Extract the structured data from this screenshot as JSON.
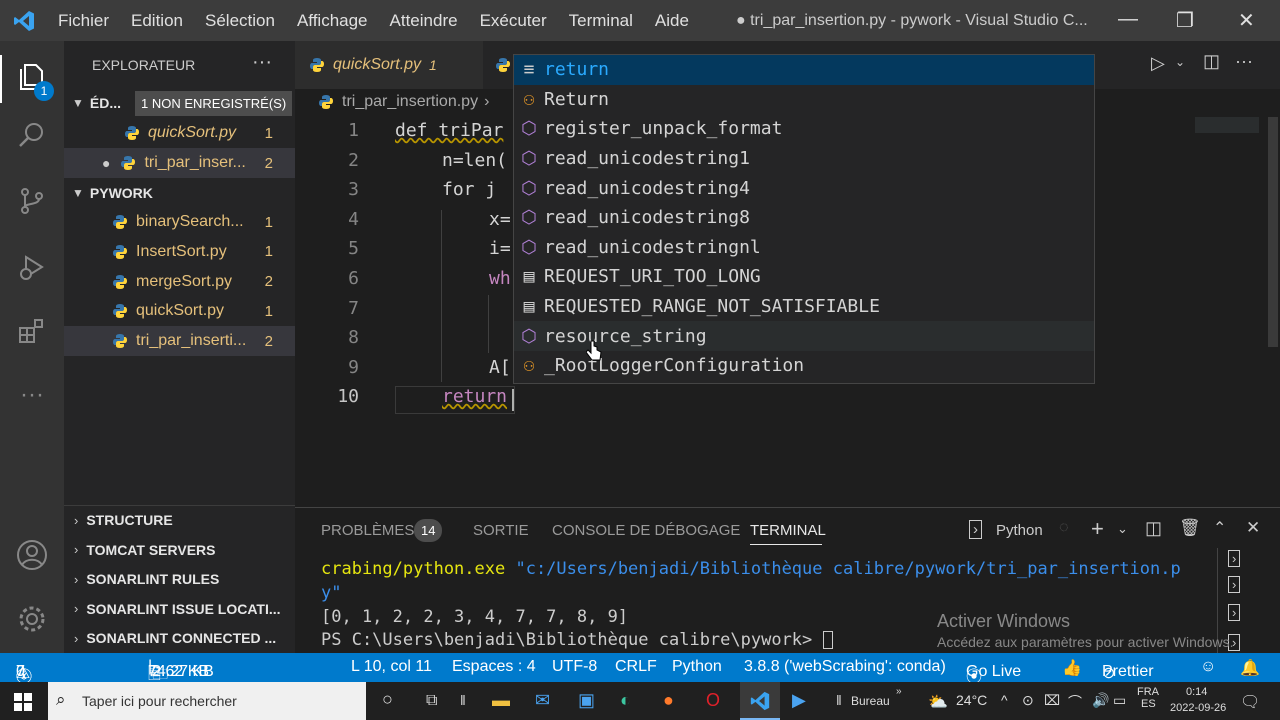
{
  "menu": [
    "Fichier",
    "Edition",
    "Sélection",
    "Affichage",
    "Atteindre",
    "Exécuter",
    "Terminal",
    "Aide"
  ],
  "window_title": "● tri_par_insertion.py - pywork - Visual Studio C...",
  "sidebar": {
    "title": "EXPLORATEUR",
    "open_editors_label": "ÉD...",
    "unsaved_label": "1 NON ENREGISTRÉ(S)",
    "open_editors": [
      {
        "name": "quickSort.py",
        "count": "1"
      },
      {
        "name": "tri_par_inser...",
        "count": "2"
      }
    ],
    "folder": "PYWORK",
    "files": [
      {
        "name": "binarySearch...",
        "count": "1"
      },
      {
        "name": "InsertSort.py",
        "count": "1"
      },
      {
        "name": "mergeSort.py",
        "count": "2"
      },
      {
        "name": "quickSort.py",
        "count": "1"
      },
      {
        "name": "tri_par_inserti...",
        "count": "2"
      }
    ],
    "sections": [
      "STRUCTURE",
      "TOMCAT SERVERS",
      "SONARLINT RULES",
      "SONARLINT ISSUE LOCATI...",
      "SONARLINT CONNECTED ..."
    ]
  },
  "tabs": [
    {
      "name": "quickSort.py",
      "count": "1"
    }
  ],
  "breadcrumb": "tri_par_insertion.py",
  "code": {
    "line_numbers": [
      "1",
      "2",
      "3",
      "4",
      "5",
      "6",
      "7",
      "8",
      "9",
      "10"
    ],
    "lines": [
      "def triPar",
      "n=len(",
      "for j",
      "x=",
      "i=",
      "wh",
      "",
      "",
      "A[",
      "return"
    ]
  },
  "suggest": [
    {
      "icon": "keyword",
      "text": "return"
    },
    {
      "icon": "class",
      "text": "Return"
    },
    {
      "icon": "method",
      "text": "register_unpack_format"
    },
    {
      "icon": "method",
      "text": "read_unicodestring1"
    },
    {
      "icon": "method",
      "text": "read_unicodestring4"
    },
    {
      "icon": "method",
      "text": "read_unicodestring8"
    },
    {
      "icon": "method",
      "text": "read_unicodestringnl"
    },
    {
      "icon": "constant",
      "text": "REQUEST_URI_TOO_LONG"
    },
    {
      "icon": "constant",
      "text": "REQUESTED_RANGE_NOT_SATISFIABLE"
    },
    {
      "icon": "method",
      "text": "resource_string"
    },
    {
      "icon": "class",
      "text": "_RootLoggerConfiguration"
    }
  ],
  "panel": {
    "tabs": [
      "PROBLÈMES",
      "SORTIE",
      "CONSOLE DE DÉBOGAGE",
      "TERMINAL"
    ],
    "problems_count": "14",
    "shell": "Python",
    "terminal_line1a": "crabing/python.exe ",
    "terminal_line1b": "\"c:/Users/benjadi/Bibliothèque calibre/pywork/tri_par_insertion.p",
    "terminal_line2": "y\"",
    "terminal_line3": "[0, 1, 2, 2, 3, 4, 7, 7, 8, 9]",
    "terminal_line4": "PS C:\\Users\\benjadi\\Bibliothèque calibre\\pywork> ",
    "activate_title": "Activer Windows",
    "activate_sub": "Accédez aux paramètres pour activer Windows."
  },
  "status": {
    "errors": "0",
    "warnings": "7",
    "infos": "7",
    "size1": "74.27 KB",
    "size2": "2.62 KB",
    "position": "L 10, col 11",
    "spaces": "Espaces : 4",
    "encoding": "UTF-8",
    "eol": "CRLF",
    "language": "Python",
    "interpreter": "3.8.8 ('webScrabing': conda)",
    "golive": "Go Live",
    "prettier": "Prettier"
  },
  "taskbar": {
    "search_placeholder": "Taper ici pour rechercher",
    "bureau": "Bureau",
    "temp": "24°C",
    "lang1": "FRA",
    "lang2": "ES",
    "time": "0:14",
    "date": "2022-09-26"
  },
  "colors": {
    "accent": "#007acc",
    "suggest_highlight": "#2aaaff",
    "selection": "#04395e"
  }
}
